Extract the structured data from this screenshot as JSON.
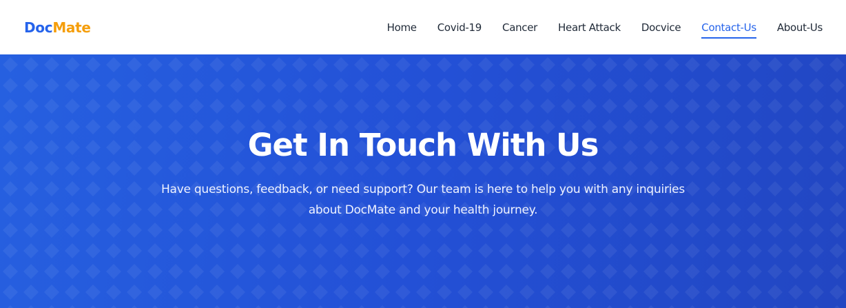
{
  "brand": {
    "name_part1": "Doc",
    "name_part2": "Mate",
    "colors": {
      "primary": "#2563eb",
      "accent": "#f59e0b",
      "hero_background": "#2350d6",
      "nav_text": "#1f2937"
    }
  },
  "nav": {
    "items": [
      {
        "label": "Home",
        "active": false
      },
      {
        "label": "Covid-19",
        "active": false
      },
      {
        "label": "Cancer",
        "active": false
      },
      {
        "label": "Heart Attack",
        "active": false
      },
      {
        "label": "Docvice",
        "active": false
      },
      {
        "label": "Contact-Us",
        "active": true
      },
      {
        "label": "About-Us",
        "active": false
      }
    ]
  },
  "hero": {
    "title": "Get In Touch With Us",
    "subtitle": "Have questions, feedback, or need support? Our team is here to help you with any inquiries about DocMate and your health journey."
  }
}
